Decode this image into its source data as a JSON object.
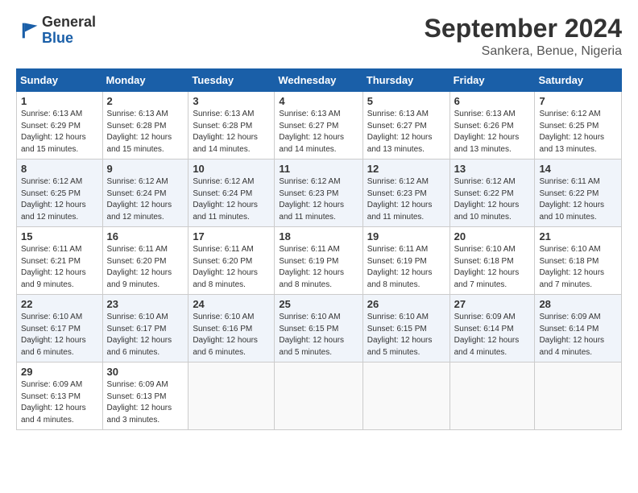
{
  "header": {
    "logo_general": "General",
    "logo_blue": "Blue",
    "month_title": "September 2024",
    "location": "Sankera, Benue, Nigeria"
  },
  "days_of_week": [
    "Sunday",
    "Monday",
    "Tuesday",
    "Wednesday",
    "Thursday",
    "Friday",
    "Saturday"
  ],
  "weeks": [
    [
      {
        "day": "1",
        "sunrise": "6:13 AM",
        "sunset": "6:29 PM",
        "daylight": "12 hours and 15 minutes."
      },
      {
        "day": "2",
        "sunrise": "6:13 AM",
        "sunset": "6:28 PM",
        "daylight": "12 hours and 15 minutes."
      },
      {
        "day": "3",
        "sunrise": "6:13 AM",
        "sunset": "6:28 PM",
        "daylight": "12 hours and 14 minutes."
      },
      {
        "day": "4",
        "sunrise": "6:13 AM",
        "sunset": "6:27 PM",
        "daylight": "12 hours and 14 minutes."
      },
      {
        "day": "5",
        "sunrise": "6:13 AM",
        "sunset": "6:27 PM",
        "daylight": "12 hours and 13 minutes."
      },
      {
        "day": "6",
        "sunrise": "6:13 AM",
        "sunset": "6:26 PM",
        "daylight": "12 hours and 13 minutes."
      },
      {
        "day": "7",
        "sunrise": "6:12 AM",
        "sunset": "6:25 PM",
        "daylight": "12 hours and 13 minutes."
      }
    ],
    [
      {
        "day": "8",
        "sunrise": "6:12 AM",
        "sunset": "6:25 PM",
        "daylight": "12 hours and 12 minutes."
      },
      {
        "day": "9",
        "sunrise": "6:12 AM",
        "sunset": "6:24 PM",
        "daylight": "12 hours and 12 minutes."
      },
      {
        "day": "10",
        "sunrise": "6:12 AM",
        "sunset": "6:24 PM",
        "daylight": "12 hours and 11 minutes."
      },
      {
        "day": "11",
        "sunrise": "6:12 AM",
        "sunset": "6:23 PM",
        "daylight": "12 hours and 11 minutes."
      },
      {
        "day": "12",
        "sunrise": "6:12 AM",
        "sunset": "6:23 PM",
        "daylight": "12 hours and 11 minutes."
      },
      {
        "day": "13",
        "sunrise": "6:12 AM",
        "sunset": "6:22 PM",
        "daylight": "12 hours and 10 minutes."
      },
      {
        "day": "14",
        "sunrise": "6:11 AM",
        "sunset": "6:22 PM",
        "daylight": "12 hours and 10 minutes."
      }
    ],
    [
      {
        "day": "15",
        "sunrise": "6:11 AM",
        "sunset": "6:21 PM",
        "daylight": "12 hours and 9 minutes."
      },
      {
        "day": "16",
        "sunrise": "6:11 AM",
        "sunset": "6:20 PM",
        "daylight": "12 hours and 9 minutes."
      },
      {
        "day": "17",
        "sunrise": "6:11 AM",
        "sunset": "6:20 PM",
        "daylight": "12 hours and 8 minutes."
      },
      {
        "day": "18",
        "sunrise": "6:11 AM",
        "sunset": "6:19 PM",
        "daylight": "12 hours and 8 minutes."
      },
      {
        "day": "19",
        "sunrise": "6:11 AM",
        "sunset": "6:19 PM",
        "daylight": "12 hours and 8 minutes."
      },
      {
        "day": "20",
        "sunrise": "6:10 AM",
        "sunset": "6:18 PM",
        "daylight": "12 hours and 7 minutes."
      },
      {
        "day": "21",
        "sunrise": "6:10 AM",
        "sunset": "6:18 PM",
        "daylight": "12 hours and 7 minutes."
      }
    ],
    [
      {
        "day": "22",
        "sunrise": "6:10 AM",
        "sunset": "6:17 PM",
        "daylight": "12 hours and 6 minutes."
      },
      {
        "day": "23",
        "sunrise": "6:10 AM",
        "sunset": "6:17 PM",
        "daylight": "12 hours and 6 minutes."
      },
      {
        "day": "24",
        "sunrise": "6:10 AM",
        "sunset": "6:16 PM",
        "daylight": "12 hours and 6 minutes."
      },
      {
        "day": "25",
        "sunrise": "6:10 AM",
        "sunset": "6:15 PM",
        "daylight": "12 hours and 5 minutes."
      },
      {
        "day": "26",
        "sunrise": "6:10 AM",
        "sunset": "6:15 PM",
        "daylight": "12 hours and 5 minutes."
      },
      {
        "day": "27",
        "sunrise": "6:09 AM",
        "sunset": "6:14 PM",
        "daylight": "12 hours and 4 minutes."
      },
      {
        "day": "28",
        "sunrise": "6:09 AM",
        "sunset": "6:14 PM",
        "daylight": "12 hours and 4 minutes."
      }
    ],
    [
      {
        "day": "29",
        "sunrise": "6:09 AM",
        "sunset": "6:13 PM",
        "daylight": "12 hours and 4 minutes."
      },
      {
        "day": "30",
        "sunrise": "6:09 AM",
        "sunset": "6:13 PM",
        "daylight": "12 hours and 3 minutes."
      },
      null,
      null,
      null,
      null,
      null
    ]
  ]
}
